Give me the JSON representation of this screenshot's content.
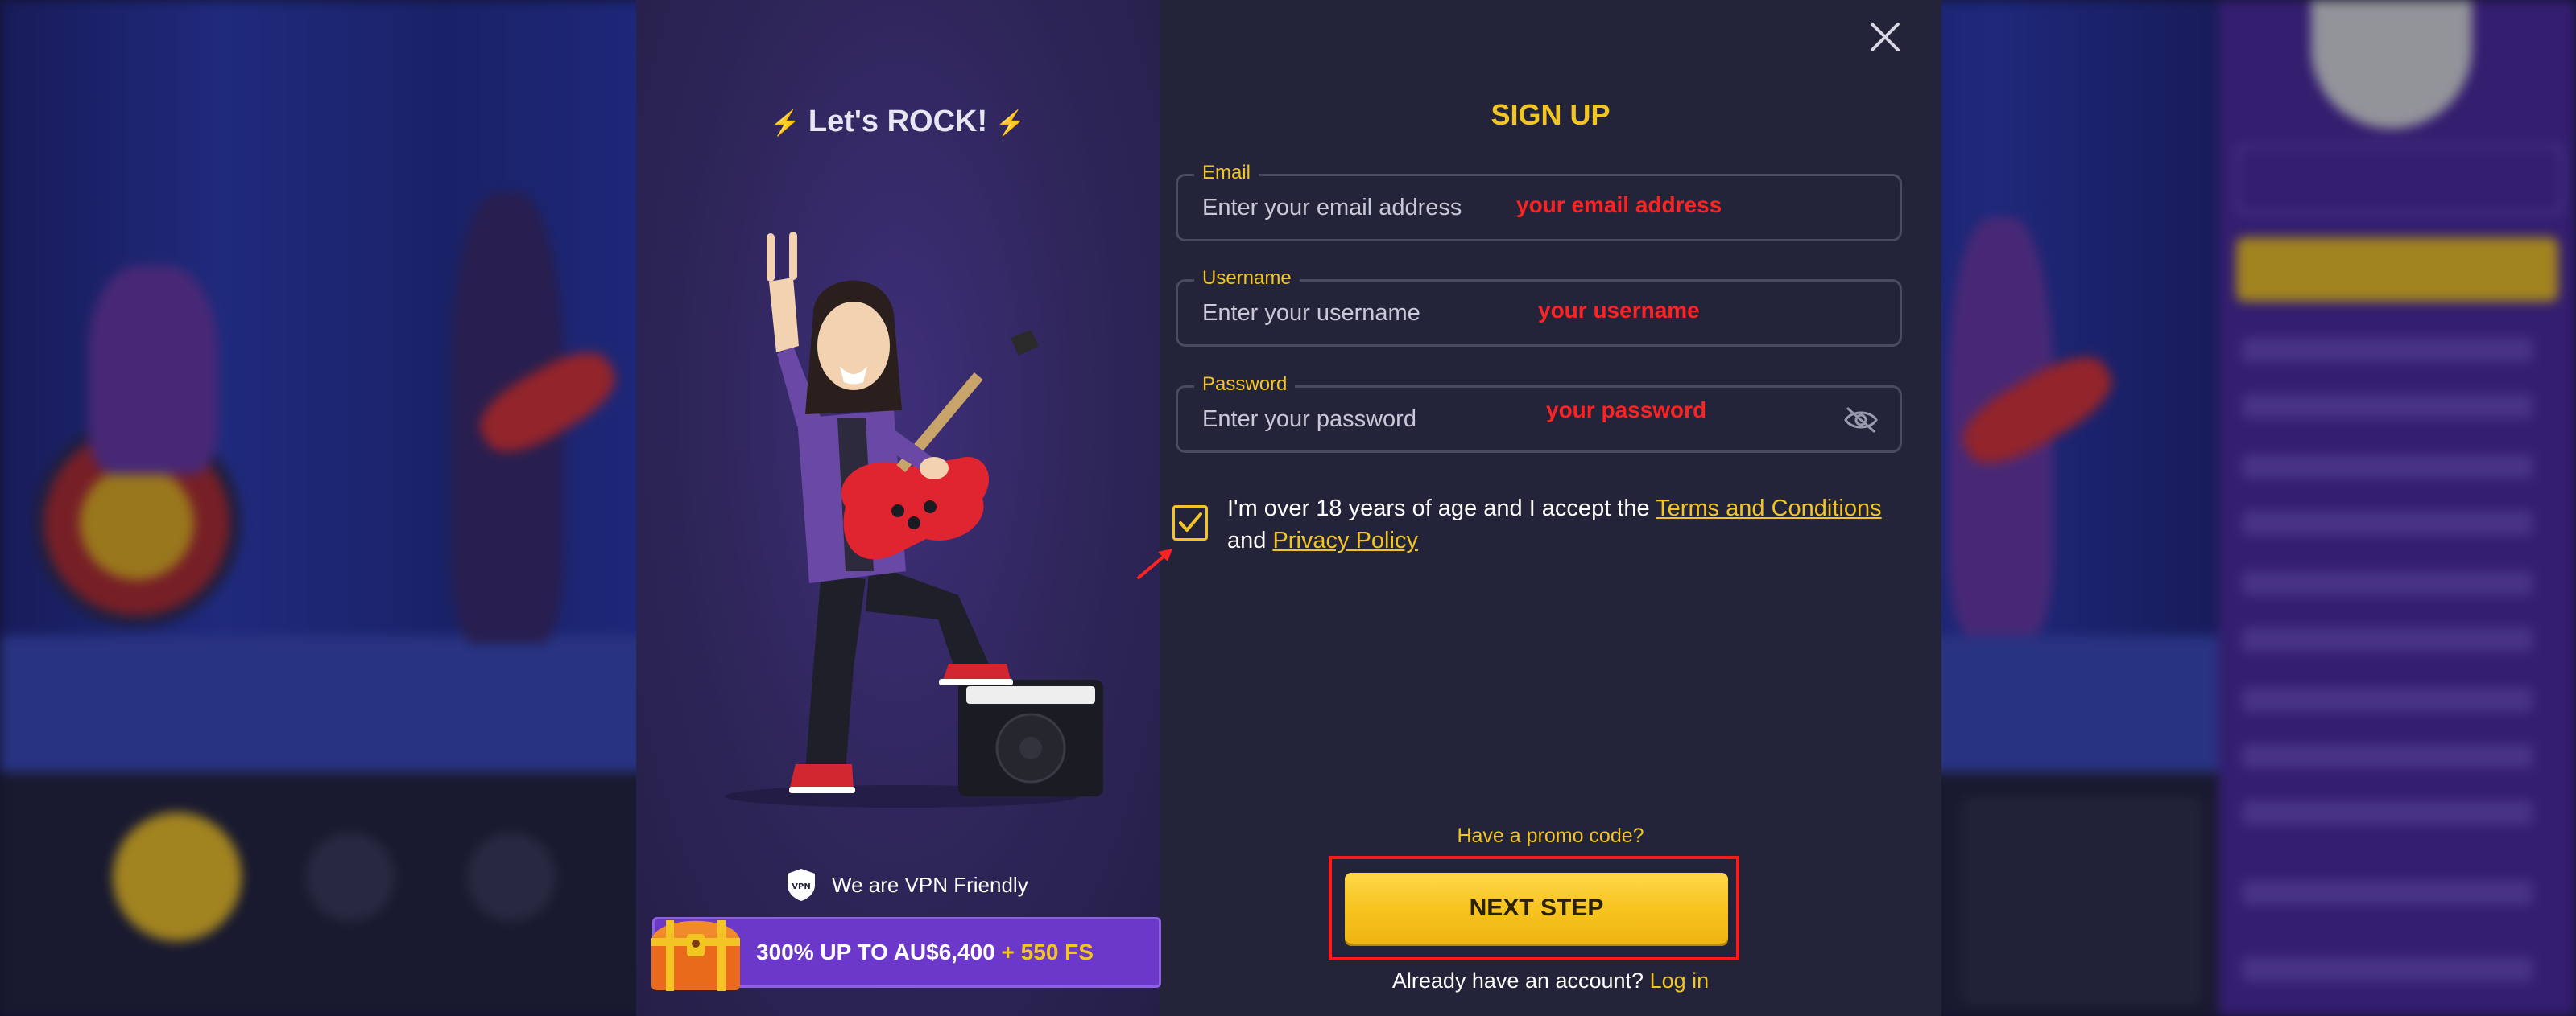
{
  "left_panel": {
    "title": "Let's ROCK!",
    "vpn_text": "We are VPN Friendly",
    "vpn_icon_label": "VPN",
    "bonus_main": "300% UP TO AU$6,400",
    "bonus_extra": "+ 550 FS"
  },
  "form": {
    "title": "SIGN UP",
    "email": {
      "label": "Email",
      "placeholder": "Enter your email address",
      "annotation": "your email address"
    },
    "username": {
      "label": "Username",
      "placeholder": "Enter your username",
      "annotation": "your username"
    },
    "password": {
      "label": "Password",
      "placeholder": "Enter your password",
      "annotation": "your password"
    },
    "terms": {
      "prefix": "I'm over 18 years of age and I accept the ",
      "terms_link": "Terms and Conditions ",
      "middle": "and ",
      "privacy_link": "Privacy Policy"
    },
    "checkbox_checked": true,
    "promo_link": "Have a promo code?",
    "next_button": "NEXT STEP",
    "already_text": "Already have an account?",
    "login_link": "Log in"
  },
  "colors": {
    "accent": "#f3c523",
    "modal_bg": "#23243a",
    "annotation_red": "#ff2222",
    "bonus_bg": "#6b38c9"
  }
}
